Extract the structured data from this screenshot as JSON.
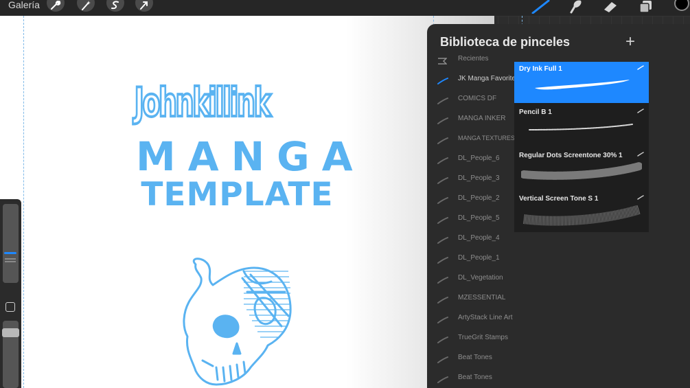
{
  "topbar": {
    "gallery_label": "Galería",
    "left_tools": [
      "wrench-icon",
      "magic-wand-icon",
      "selection-icon",
      "transform-icon"
    ],
    "right_tools": [
      "brush-icon",
      "smudge-icon",
      "eraser-icon",
      "layers-icon",
      "color-swatch"
    ],
    "accent_color": "#1e88ff",
    "current_color": "#000000"
  },
  "canvas": {
    "line1": "Johnkillink",
    "line2": "MANGA",
    "line3": "TEMPLATE",
    "art_color": "#5ab3f1"
  },
  "sidebar": {
    "size_slider_icon": "size-slider",
    "modify_button_icon": "square-icon",
    "opacity_slider_icon": "opacity-slider"
  },
  "brush_library": {
    "title": "Biblioteca de pinceles",
    "add_icon": "plus-icon",
    "sets": [
      {
        "label": "Recientes"
      },
      {
        "label": "JK Manga Favorites",
        "active": true
      },
      {
        "label": "COMICS DF"
      },
      {
        "label": "MANGA INKER"
      },
      {
        "label": "MANGA TEXTURES"
      },
      {
        "label": "DL_People_6"
      },
      {
        "label": "DL_People_3"
      },
      {
        "label": "DL_People_2"
      },
      {
        "label": "DL_People_5"
      },
      {
        "label": "DL_People_4"
      },
      {
        "label": "DL_People_1"
      },
      {
        "label": "DL_Vegetation"
      },
      {
        "label": "MZESSENTIAL"
      },
      {
        "label": "ArtyStack Line Art"
      },
      {
        "label": "TrueGrit Stamps"
      },
      {
        "label": "Beat Tones"
      },
      {
        "label": "Beat Tones"
      }
    ],
    "brushes": [
      {
        "name": "Dry Ink Full 1",
        "selected": true
      },
      {
        "name": "Pencil B 1"
      },
      {
        "name": "Regular Dots Screentone 30% 1"
      },
      {
        "name": "Vertical Screen Tone S 1"
      }
    ]
  }
}
